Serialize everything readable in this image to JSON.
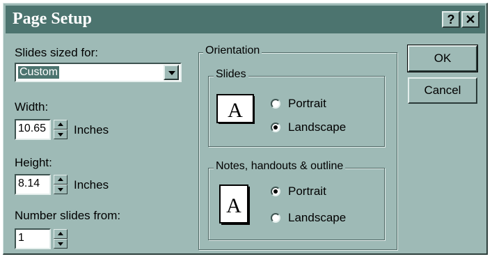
{
  "window": {
    "title": "Page Setup",
    "help_button": "?",
    "close_button": "✕"
  },
  "left": {
    "slides_sized_for_label": "Slides sized for:",
    "slides_sized_for_value": "Custom",
    "width_label": "Width:",
    "width_value": "10.65",
    "width_unit": "Inches",
    "height_label": "Height:",
    "height_value": "8.14",
    "height_unit": "Inches",
    "number_from_label": "Number slides from:",
    "number_from_value": "1"
  },
  "orientation": {
    "group_label": "Orientation",
    "slides": {
      "label": "Slides",
      "portrait": "Portrait",
      "landscape": "Landscape",
      "selected": "Landscape"
    },
    "notes": {
      "label": "Notes, handouts & outline",
      "portrait": "Portrait",
      "landscape": "Landscape",
      "selected": "Portrait"
    }
  },
  "buttons": {
    "ok": "OK",
    "cancel": "Cancel"
  },
  "icons": {
    "page_icon_glyph": "A"
  },
  "colors": {
    "face": "#9ebab6",
    "title_bar": "#4c746f",
    "selection": "#4c746f"
  }
}
